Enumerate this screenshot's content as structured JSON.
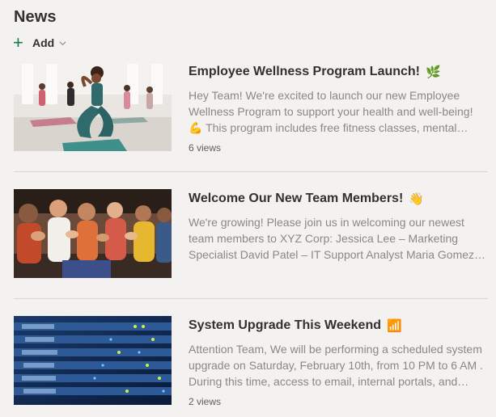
{
  "section_title": "News",
  "add": {
    "label": "Add"
  },
  "items": [
    {
      "title": "Employee Wellness Program Launch!",
      "emoji": "🌿",
      "snippet": "Hey Team! We're excited to launch our new Employee Wellness Program to support your health and well-being! 💪 This program includes free fitness classes, mental health resources and more.",
      "views": "6 views",
      "image": "yoga-class-photo"
    },
    {
      "title": "Welcome Our New Team Members!",
      "emoji": "👋",
      "snippet": "We're growing! Please join us in welcoming our newest team members to XYZ Corp: Jessica Lee – Marketing Specialist David Patel – IT Support Analyst Maria Gomez – HR Coordinator",
      "views": "",
      "image": "applauding-audience-photo"
    },
    {
      "title": "System Upgrade This Weekend",
      "emoji": "📶",
      "snippet": "Attention Team, We will be performing a scheduled system upgrade on Saturday, February 10th, from 10 PM to 6 AM . During this time, access to email, internal portals, and shared drives may be unavailable.",
      "views": "2 views",
      "image": "server-rack-photo"
    }
  ],
  "colors": {
    "accent_plus": "#107c41",
    "background": "#f3f2f1",
    "snippet_text": "#8a8886"
  }
}
